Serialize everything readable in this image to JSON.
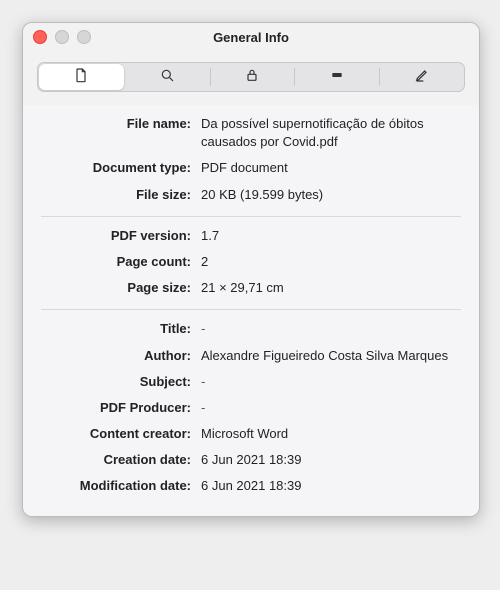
{
  "window": {
    "title": "General Info"
  },
  "tabs": {
    "items": [
      "file-info",
      "search",
      "security",
      "display",
      "edit"
    ],
    "active_index": 0
  },
  "groups": [
    {
      "rows": [
        {
          "label": "File name:",
          "value": "Da possível supernotificação de óbitos causados por Covid.pdf"
        },
        {
          "label": "Document type:",
          "value": "PDF document"
        },
        {
          "label": "File size:",
          "value": "20 KB (19.599 bytes)"
        }
      ]
    },
    {
      "rows": [
        {
          "label": "PDF version:",
          "value": "1.7"
        },
        {
          "label": "Page count:",
          "value": "2"
        },
        {
          "label": "Page size:",
          "value": "21 × 29,71 cm"
        }
      ]
    },
    {
      "rows": [
        {
          "label": "Title:",
          "value": "-"
        },
        {
          "label": "Author:",
          "value": "Alexandre Figueiredo Costa Silva Marques"
        },
        {
          "label": "Subject:",
          "value": "-"
        },
        {
          "label": "PDF Producer:",
          "value": "-"
        },
        {
          "label": "Content creator:",
          "value": "Microsoft Word"
        },
        {
          "label": "Creation date:",
          "value": "6 Jun 2021 18:39"
        },
        {
          "label": "Modification date:",
          "value": "6 Jun 2021 18:39"
        }
      ]
    }
  ]
}
